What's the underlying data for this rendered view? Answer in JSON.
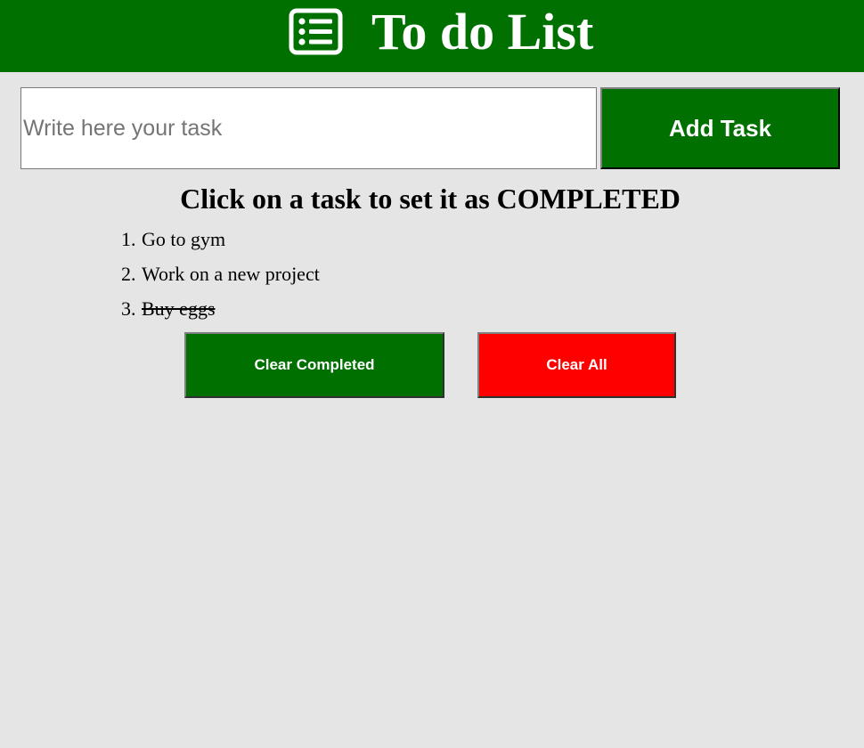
{
  "header": {
    "icon": "list-icon",
    "title": "To do List"
  },
  "input": {
    "placeholder": "Write here your task",
    "value": ""
  },
  "add_button": {
    "label": "Add Task"
  },
  "instruction": "Click on a task to set it as COMPLETED",
  "tasks": [
    {
      "number": "1.",
      "text": "Go to gym",
      "completed": false
    },
    {
      "number": "2.",
      "text": "Work on a new project",
      "completed": false
    },
    {
      "number": "3.",
      "text": "Buy eggs",
      "completed": true
    }
  ],
  "actions": {
    "clear_completed_label": "Clear Completed",
    "clear_all_label": "Clear All"
  },
  "colors": {
    "header_bg": "#007100",
    "page_bg": "#e5e5e5",
    "primary_button": "#007100",
    "danger_button": "#ff0000",
    "button_text": "#ffffff"
  }
}
